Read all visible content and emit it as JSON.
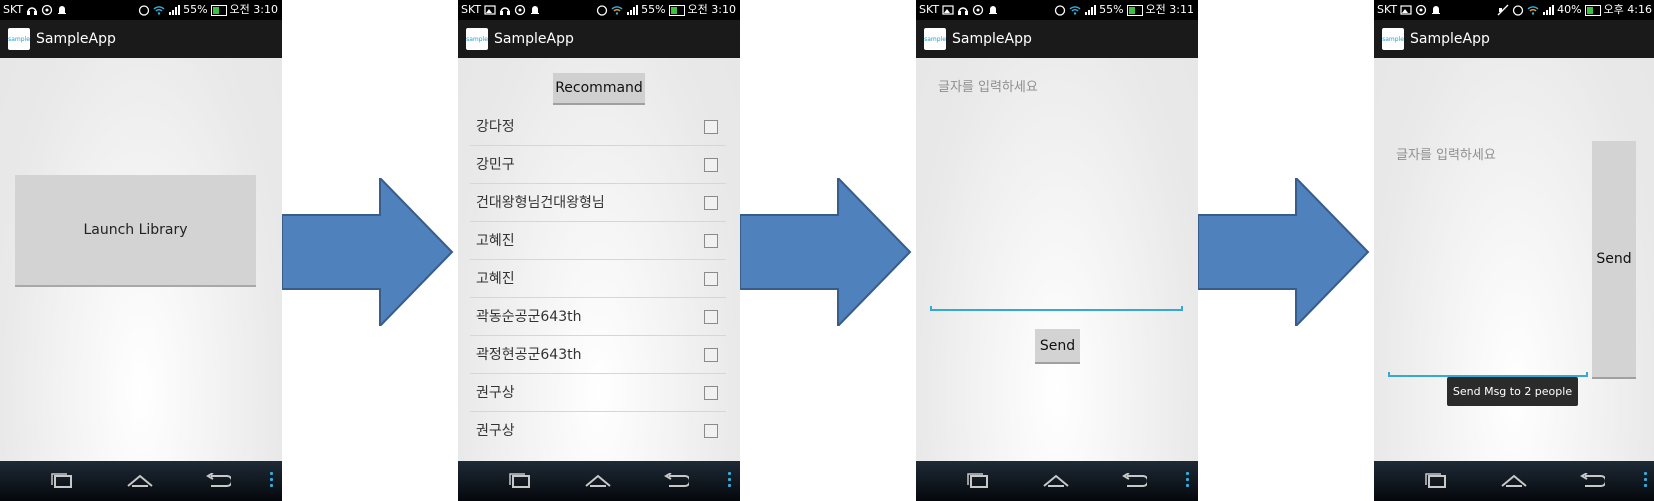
{
  "status_bars": [
    {
      "carrier": "SKT",
      "battery": "55%",
      "time": "오전 3:10"
    },
    {
      "carrier": "SKT",
      "battery": "55%",
      "time": "오전 3:10"
    },
    {
      "carrier": "SKT",
      "battery": "55%",
      "time": "오전 3:11"
    },
    {
      "carrier": "SKT",
      "battery": "40%",
      "time": "오후 4:16"
    }
  ],
  "app": {
    "title": "SampleApp",
    "logo_text": "sample"
  },
  "screen1": {
    "launch_label": "Launch Library"
  },
  "screen2": {
    "recommand_label": "Recommand",
    "contacts": [
      "강다정",
      "강민구",
      "건대왕형님건대왕형님",
      "고혜진",
      "고혜진",
      "곽동순공군643th",
      "곽정현공군643th",
      "권구상",
      "권구상"
    ]
  },
  "screen3": {
    "input_placeholder": "글자를 입력하세요",
    "send_label": "Send"
  },
  "screen4": {
    "input_placeholder": "글자를 입력하세요",
    "send_label": "Send",
    "toast": "Send Msg to 2 people"
  },
  "colors": {
    "accent": "#37a8d6",
    "arrow_fill": "#4f81bd",
    "arrow_stroke": "#385d8a"
  },
  "icons": {
    "nav": [
      "recent-apps-icon",
      "home-icon",
      "back-icon",
      "menu-icon"
    ]
  }
}
